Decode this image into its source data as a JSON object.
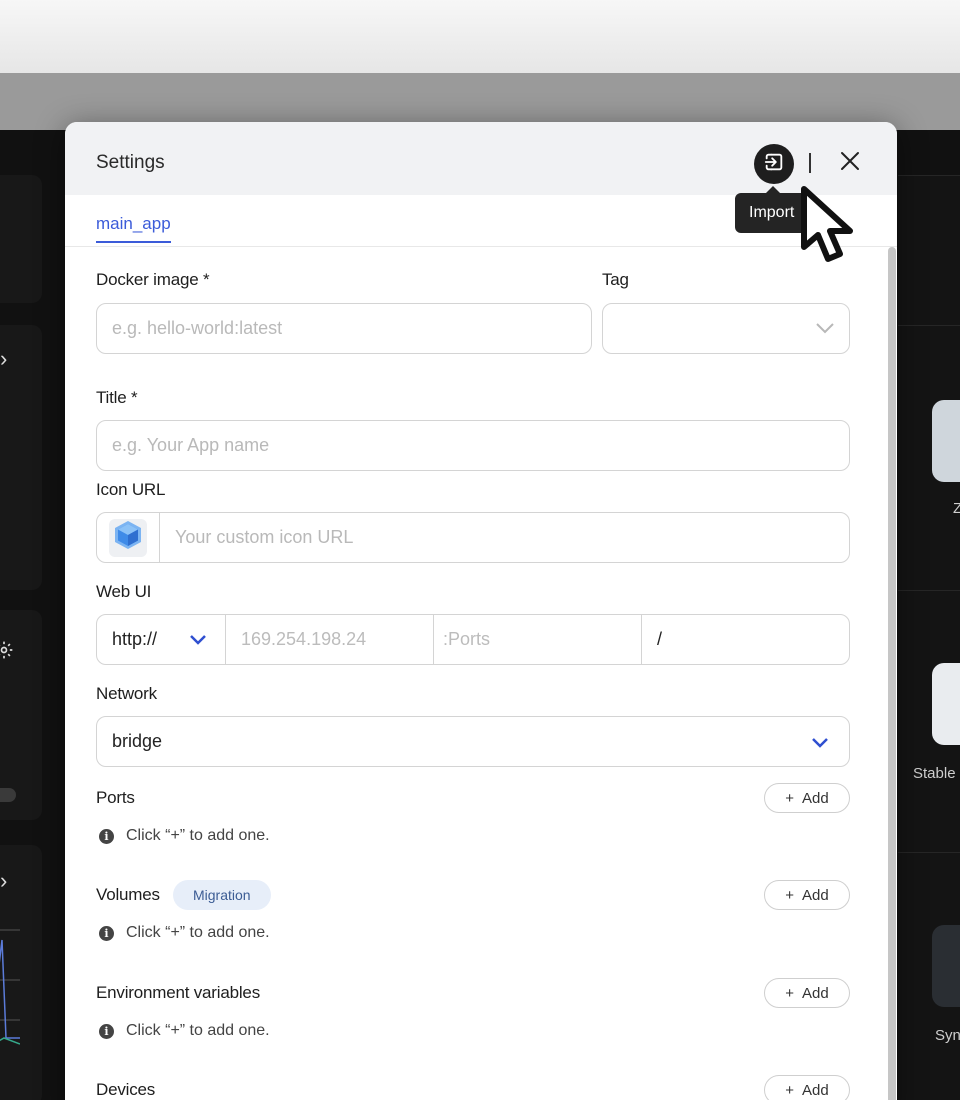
{
  "dialog": {
    "title": "Settings",
    "import_tooltip": "Import",
    "tab": "main_app"
  },
  "form": {
    "docker_image": {
      "label": "Docker image *",
      "placeholder": "e.g. hello-world:latest"
    },
    "tag": {
      "label": "Tag",
      "value": ""
    },
    "title": {
      "label": "Title *",
      "placeholder": "e.g. Your App name"
    },
    "icon_url": {
      "label": "Icon URL",
      "placeholder": "Your custom icon URL"
    },
    "web_ui": {
      "label": "Web UI",
      "protocol": "http://",
      "host": "169.254.198.24",
      "ports": ":Ports",
      "path": "/"
    },
    "network": {
      "label": "Network",
      "value": "bridge"
    },
    "ports": {
      "label": "Ports",
      "add": "Add",
      "hint": "Click “+” to add one."
    },
    "volumes": {
      "label": "Volumes",
      "badge": "Migration",
      "add": "Add",
      "hint": "Click “+” to add one."
    },
    "env": {
      "label": "Environment variables",
      "add": "Add",
      "hint": "Click “+” to add one."
    },
    "devices": {
      "label": "Devices",
      "add": "Add"
    }
  },
  "background": {
    "app_label_1": "Z",
    "app_label_2": "Stable",
    "app_label_3": "Syn"
  },
  "colors": {
    "accent": "#3b5bd9",
    "header_bg": "#f1f2f4",
    "badge_bg": "#e7eef9",
    "tooltip_bg": "#242424"
  }
}
